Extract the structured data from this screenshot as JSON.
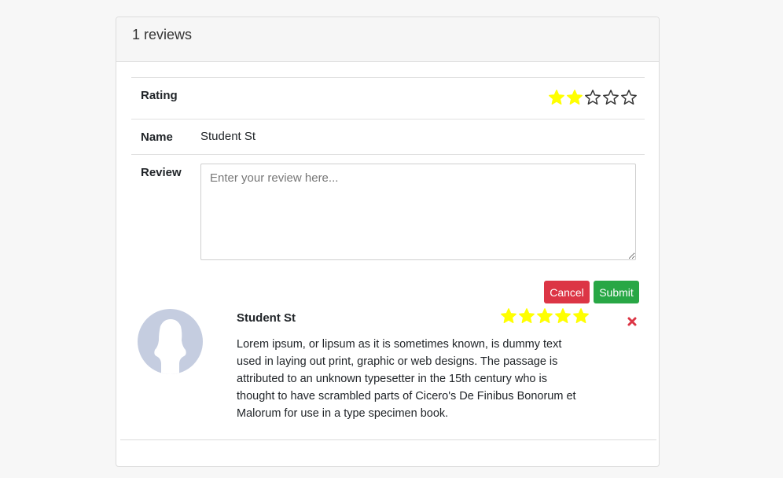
{
  "header": {
    "title": "1 reviews"
  },
  "form": {
    "rating_label": "Rating",
    "rating_value": 2,
    "rating_max": 5,
    "name_label": "Name",
    "name_value": "Student St",
    "review_label": "Review",
    "review_placeholder": "Enter your review here...",
    "cancel_label": "Cancel",
    "submit_label": "Submit"
  },
  "reviews": [
    {
      "author": "Student St",
      "rating": 5,
      "rating_max": 5,
      "text": "Lorem ipsum, or lipsum as it is sometimes known, is dummy text used in laying out print, graphic or web designs. The passage is attributed to an unknown typesetter in the 15th century who is thought to have scrambled parts of Cicero's De Finibus Bonorum et Malorum for use in a type specimen book."
    }
  ],
  "colors": {
    "star_filled": "#ffff00",
    "star_empty_stroke": "#333333",
    "cancel": "#dc3545",
    "submit": "#28a745",
    "delete": "#dc3545",
    "avatar_bg": "#c5cde0"
  },
  "icons": {
    "delete": "close-icon",
    "avatar": "user-silhouette-icon",
    "star": "star-icon"
  }
}
